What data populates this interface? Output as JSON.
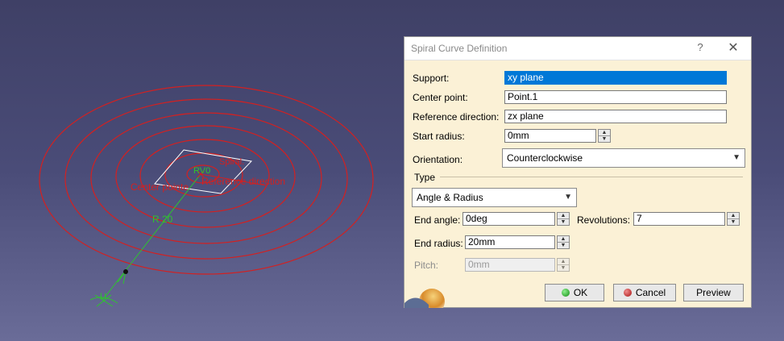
{
  "viewport": {
    "labels": {
      "center_label": "Center pointe",
      "ref_label": "Reference direction",
      "spiral_label": "Spiral.",
      "radius_label": "R 20",
      "rv_label": "RV0",
      "origin_label": "U"
    },
    "colors": {
      "spiral": "#d42020",
      "axis": "#2ec42e",
      "plane": "#ffffff"
    }
  },
  "dialog": {
    "title": "Spiral Curve Definition",
    "help": "?",
    "close": "✕",
    "support": {
      "label": "Support:",
      "value": "xy plane"
    },
    "center": {
      "label": "Center point:",
      "value": "Point.1"
    },
    "refdir": {
      "label": "Reference direction:",
      "value": "zx plane"
    },
    "start_radius": {
      "label": "Start radius:",
      "value": "0mm"
    },
    "orientation": {
      "label": "Orientation:",
      "value": "Counterclockwise"
    },
    "type": {
      "label": "Type",
      "value": "Angle & Radius"
    },
    "end_angle": {
      "label": "End angle:",
      "value": "0deg"
    },
    "revolutions": {
      "label": "Revolutions:",
      "value": "7"
    },
    "end_radius": {
      "label": "End radius:",
      "value": "20mm"
    },
    "pitch": {
      "label": "Pitch:",
      "value": "0mm"
    },
    "buttons": {
      "ok": "OK",
      "cancel": "Cancel",
      "preview": "Preview"
    },
    "icons": {
      "ok": "green-dot-icon",
      "cancel": "red-dot-icon"
    }
  }
}
